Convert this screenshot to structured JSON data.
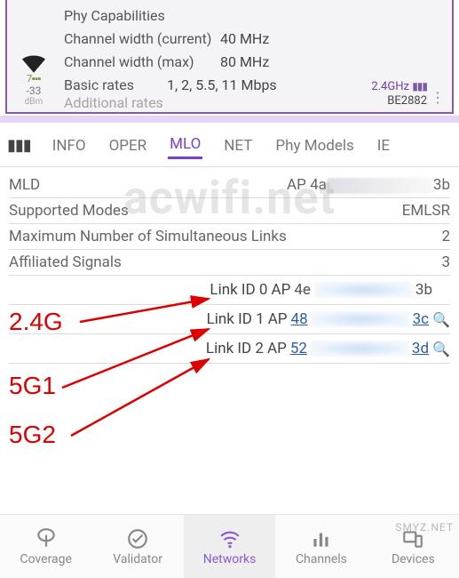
{
  "top_card": {
    "phy_cap_label": "Phy Capabilities",
    "chw_current_label": "Channel width (current)",
    "chw_current_value": "40 MHz",
    "chw_max_label": "Channel width (max)",
    "chw_max_value": "80 MHz",
    "basic_rates_label": "Basic rates",
    "basic_rates_value": "1, 2, 5.5, 11 Mbps",
    "additional_label": "Additional rates",
    "signal_value": "-33",
    "signal_unit": "dBm",
    "band_link": "2.4GHz",
    "phy_model": "BE2882",
    "wifi_gen": "7"
  },
  "tabs": {
    "info": "INFO",
    "oper": "OPER",
    "mlo": "MLO",
    "net": "NET",
    "phy": "Phy Models",
    "ie": "IE"
  },
  "mlo": {
    "mld_label": "MLD",
    "mld_ap_prefix": "AP 4a",
    "mld_ap_suffix": "3b",
    "modes_label": "Supported Modes",
    "modes_value": "EMLSR",
    "maxlinks_label": "Maximum Number of Simultaneous Links",
    "maxlinks_value": "2",
    "affiliated_label": "Affiliated Signals",
    "affiliated_value": "3",
    "links": [
      {
        "id_label": "Link ID 0",
        "ap": "AP",
        "head": "4e",
        "tail": "3b",
        "clickable": false
      },
      {
        "id_label": "Link ID 1",
        "ap": "AP",
        "head": "48",
        "tail": "3c",
        "clickable": true
      },
      {
        "id_label": "Link ID 2",
        "ap": "AP",
        "head": "52",
        "tail": "3d",
        "clickable": true
      }
    ]
  },
  "annotations": {
    "a": "2.4G",
    "b": "5G1",
    "c": "5G2"
  },
  "nav": {
    "coverage": "Coverage",
    "validator": "Validator",
    "networks": "Networks",
    "channels": "Channels",
    "devices": "Devices"
  },
  "watermark": "acwifi.net",
  "watermark2": "SMYZ.NET"
}
